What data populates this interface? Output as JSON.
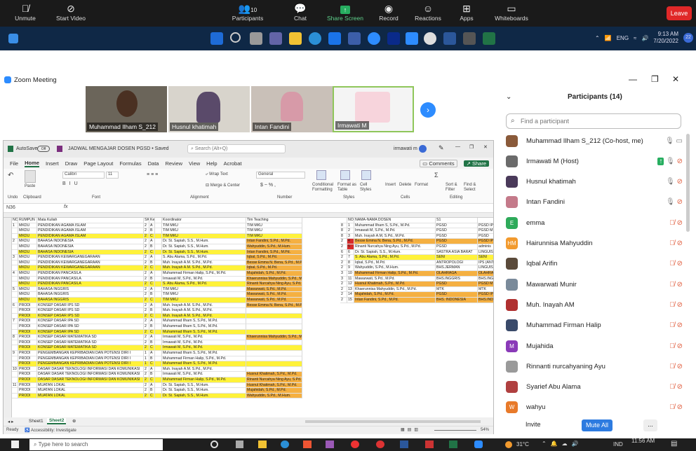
{
  "zoom_toolbar": {
    "unmute": "Unmute",
    "start_video": "Start Video",
    "participants": "Participants",
    "participants_count": "10",
    "chat": "Chat",
    "share": "Share Screen",
    "record": "Record",
    "reactions": "Reactions",
    "apps": "Apps",
    "whiteboards": "Whiteboards",
    "leave": "Leave"
  },
  "taskbar1": {
    "lang": "ENG",
    "time": "9:13 AM",
    "date": "7/20/2022",
    "badge": "22"
  },
  "zoom_window": {
    "title": "Zoom Meeting"
  },
  "gallery": [
    {
      "name": "Muhammad Ilham S_212"
    },
    {
      "name": "Husnul khatimah"
    },
    {
      "name": "Intan Fandini"
    },
    {
      "name": "Irmawati M"
    }
  ],
  "excel": {
    "autosave": "AutoSave",
    "autosave_state": "Off",
    "doc": "JADWAL MENGAJAR DOSEN PGSD • Saved",
    "search": "Search (Alt+Q)",
    "user": "irmawati m",
    "tabs": [
      "File",
      "Home",
      "Insert",
      "Draw",
      "Page Layout",
      "Formulas",
      "Data",
      "Review",
      "View",
      "Help",
      "Acrobat"
    ],
    "comments": "Comments",
    "share": "Share",
    "namebox": "N36",
    "fx": "fx",
    "ribbon": {
      "paste": "Paste",
      "clipboard": "Clipboard",
      "font": "Calibri",
      "size": "11",
      "font_group": "Font",
      "alignment": "Alignment",
      "wrap": "Wrap Text",
      "merge": "Merge & Center",
      "number_fmt": "General",
      "number": "Number",
      "cond": "Conditional Formatting",
      "fmt_table": "Format as Table",
      "cell_styles": "Cell Styles",
      "styles": "Styles",
      "insert": "Insert",
      "delete": "Delete",
      "format": "Format",
      "cells": "Cells",
      "sort": "Sort & Filter",
      "find": "Find & Select",
      "editing": "Editing",
      "undo": "Undo"
    },
    "headers": {
      "no": "NO",
      "rumpun": "RUMPUN",
      "mk": "Mata Kuliah",
      "sks": "SKS",
      "kelas": "Kelas",
      "koord": "Koordinator",
      "tim": "Tim Teaching"
    },
    "rows": [
      [
        "1",
        "MKDU",
        "PENDIDIKAN AGAMA ISLAM",
        "2",
        "A",
        "",
        "TIM MKU",
        "TIM MKU"
      ],
      [
        "",
        "MKDU",
        "PENDIDIKAN AGAMA ISLAM",
        "2",
        "B",
        "",
        "TIM MKU",
        "TIM MKU"
      ],
      [
        "",
        "MKDU",
        "PENDIDIKAN AGAMA ISLAM",
        "2",
        "C",
        "",
        "TIM MKU",
        "TIM MKU"
      ],
      [
        "2",
        "MKDU",
        "BAHASA INDONESIA",
        "2",
        "A",
        "",
        "Dr. St. Sapiah, S.S., M.Hum.",
        "Intan Fandini, S.Pd., M.Pd."
      ],
      [
        "",
        "MKDU",
        "BAHASA INDONESIA",
        "2",
        "B",
        "",
        "Dr. St. Sapiah, S.S., M.Hum.",
        "Wahyuddin, S.Pd., M.Hum."
      ],
      [
        "",
        "MKDU",
        "BAHASA INDONESIA",
        "2",
        "C",
        "",
        "Dr. St. Sapiah, S.S., M.Hum.",
        "Intan Fandini, S.Pd., M.Pd."
      ],
      [
        "3",
        "MKDU",
        "PENDIDIKAN KEWARGANEGARAAN",
        "2",
        "A",
        "",
        "S. Abu Alama, S.Pd., M.Pd.",
        "Iqbal, S.Pd., M.Pd."
      ],
      [
        "",
        "MKDU",
        "PENDIDIKAN KEWARGANEGARAAN",
        "2",
        "B",
        "",
        "Muh. Inayah A.M. S.Pd., M.Pd.",
        "Besse Emma N. Bena, S.Pd., M.Pd."
      ],
      [
        "",
        "MKDU",
        "PENDIDIKAN KEWARGANEGARAAN",
        "2",
        "C",
        "",
        "Muh. Inayah A.M. S.Pd., M.Pd.",
        "Iqbal, S.Pd., M.Pd."
      ],
      [
        "4",
        "MKDU",
        "PENDIDIKAN PANCASILA",
        "2",
        "A",
        "",
        "Muhammad Firman Halip, S.Pd., M.Pd.",
        "Mujahidah, S.Pd., M.Pd."
      ],
      [
        "",
        "MKDU",
        "PENDIDIKAN PANCASILA",
        "2",
        "B",
        "",
        "Irmawati M, S.Pd., M.Pd.",
        "Khaerunnisa Mahyuddin, S.Pd., M.Pd."
      ],
      [
        "",
        "MKDU",
        "PENDIDIKAN PANCASILA",
        "2",
        "C",
        "",
        "S. Abu Alama, S.Pd., M.Pd.",
        "Rinanti Nurcahya Ning Ayu, S.Pd., M.Pd."
      ],
      [
        "5",
        "MKDU",
        "BAHASA INGGRIS",
        "2",
        "A",
        "",
        "TIM MKU",
        "Mawarwati, S.Pd., M.Pd."
      ],
      [
        "",
        "MKDU",
        "BAHASA INGGRIS",
        "2",
        "B",
        "",
        "TIM MKU",
        "Mawarwati, S.Pd., M.Pd."
      ],
      [
        "",
        "MKDU",
        "BAHASA INGGRIS",
        "2",
        "C",
        "",
        "TIM MKU",
        "Mawarwati, S.Pd., M.Pd."
      ],
      [
        "6",
        "PRODI",
        "KONSEP DASAR IPS SD",
        "2",
        "A",
        "",
        "Muh. Inayah A.M. S.Pd., M.Pd.",
        "Besse Emma N. Bena, S.Pd., M.Pd."
      ],
      [
        "",
        "PRODI",
        "KONSEP DASAR IPS SD",
        "2",
        "B",
        "",
        "Muh. Inayah A.M. S.Pd., M.Pd.",
        ""
      ],
      [
        "",
        "PRODI",
        "KONSEP DASAR IPS SD",
        "2",
        "C",
        "",
        "Muh. Inayah A.M. S.Pd., M.Pd.",
        ""
      ],
      [
        "7",
        "PRODI",
        "KONSEP DASAR IPA SD",
        "2",
        "A",
        "",
        "Muhammad Ilham S, S.Pd., M.Pd.",
        ""
      ],
      [
        "",
        "PRODI",
        "KONSEP DASAR IPA SD",
        "2",
        "B",
        "",
        "Muhammad Ilham S, S.Pd., M.Pd.",
        ""
      ],
      [
        "",
        "PRODI",
        "KONSEP DASAR IPA SD",
        "2",
        "C",
        "",
        "Muhammad Ilham S, S.Pd., M.Pd.",
        ""
      ],
      [
        "8",
        "PRODI",
        "KONSEP DASAR MATEMATIKA SD",
        "2",
        "A",
        "",
        "Irmawati M, S.Pd., M.Pd.",
        "Khaerunnisa Mahyuddin, S.Pd., M.Pd."
      ],
      [
        "",
        "PRODI",
        "KONSEP DASAR MATEMATIKA SD",
        "2",
        "B",
        "",
        "Irmawati M, S.Pd., M.Pd.",
        ""
      ],
      [
        "",
        "PRODI",
        "KONSEP DASAR MATEMATIKA SD",
        "2",
        "C",
        "",
        "Irmawati M, S.Pd., M.Pd.",
        ""
      ],
      [
        "9",
        "PRODI",
        "PENGEMBANGAN KEPRIBADIAN DAN POTENSI DIRI I",
        "1",
        "A",
        "",
        "Muhammad Ilham S, S.Pd., M.Pd.",
        ""
      ],
      [
        "",
        "PRODI",
        "PENGEMBANGAN KEPRIBADIAN DAN POTENSI DIRI I",
        "1",
        "B",
        "",
        "Muhammad Firman Halip, S.Pd., M.Pd.",
        ""
      ],
      [
        "",
        "PRODI",
        "PENGEMBANGAN KEPRIBADIAN DAN POTENSI DIRI I",
        "1",
        "C",
        "",
        "Muhammad Ilham S, S.Pd., M.Pd.",
        ""
      ],
      [
        "10",
        "PRODI",
        "DASAR DASAR TEKNOLOGI INFORMASI DAN KOMUNIKASI",
        "2",
        "A",
        "",
        "Muh. Inayah A.M. S.Pd., M.Pd.",
        ""
      ],
      [
        "",
        "PRODI",
        "DASAR DASAR TEKNOLOGI INFORMASI DAN KOMUNIKASI",
        "2",
        "B",
        "",
        "Irmawati M, S.Pd., M.Pd.",
        "Husnul Khatimah, S.Pd., M.Pd."
      ],
      [
        "",
        "PRODI",
        "DASAR DASAR TEKNOLOGI INFORMASI DAN KOMUNIKASI",
        "2",
        "C",
        "",
        "Muhammad Firman Halip, S.Pd., M.Pd.",
        "Rinanti Nurcahya Ning Ayu, S.Pd., M.Pd."
      ],
      [
        "11",
        "PRODI",
        "MUATAN LOKAL",
        "2",
        "A",
        "",
        "Dr. St. Sapiah, S.S., M.Hum.",
        "Husnul Khatimah, S.Pd., M.Pd."
      ],
      [
        "",
        "PRODI",
        "MUATAN LOKAL",
        "2",
        "B",
        "",
        "Dr. St. Sapiah, S.S., M.Hum.",
        "Mujahidah, S.Pd., M.Pd."
      ],
      [
        "",
        "PRODI",
        "MUATAN LOKAL",
        "2",
        "C",
        "",
        "Dr. St. Sapiah, S.S., M.Hum.",
        "Wahyuddin, S.Pd., M.Hum."
      ]
    ],
    "right_headers": {
      "no": "NO",
      "nama": "NAMA-NAMA DOSEN",
      "s1": "S1"
    },
    "right_rows": [
      [
        "8",
        "1",
        "Muhammad Ilham S, S.Pd., M.Pd.",
        "PGSD",
        "PGSD IP"
      ],
      [
        "8",
        "2",
        "Irmawati M, S.Pd., M.Pd.",
        "PGSD",
        "PGSD M"
      ],
      [
        "8",
        "3",
        "Muh. Inayah A.M, S.Pd., M.Pd.",
        "PGSD",
        "PGSD"
      ],
      [
        "2",
        "4",
        "Besse Emma N. Bena, S.Pd., M.Pd.",
        "PGSD",
        "PGSD IP"
      ],
      [
        "2",
        "5",
        "Rinanti Nurcahya Ning Ayu, S.Pd., M.Pd.",
        "PGSD",
        "adminis"
      ],
      [
        "6",
        "6",
        "Dr. St. Sapiah, S.S., M.Hum.",
        "SASTRA ASIA BARAT",
        "LINGUIS"
      ],
      [
        "2",
        "7",
        "S. Abu Alama, S.Pd., M.Pd.",
        "SENI",
        "SENI"
      ],
      [
        "2",
        "8",
        "Iqbal, S.Pd., M.Pd.",
        "ANTROPOLOGI",
        "IPS (ANT"
      ],
      [
        "2",
        "9",
        "Wahyuddin, S.Pd., M.Hum.",
        "BHS.JERMAN",
        "LINGUIS"
      ],
      [
        "3",
        "10",
        "Muhammad Firman Halip, S.Pd., M.Pd.",
        "OLAHRAGA",
        "OLAHRA"
      ],
      [
        "3",
        "11",
        "Mawarwati, S.Pd., M.Pd.",
        "BHS.INGGRIS",
        "BHS.ING"
      ],
      [
        "2",
        "12",
        "Husnul Khatimah, S.Pd., M.Pd.",
        "PGSD",
        "PGSD M"
      ],
      [
        "2",
        "13",
        "Khaerunnisa Mahyuddin, S.Pd., M.Pd.",
        "MTK",
        "MTK"
      ],
      [
        "2",
        "14",
        "Mujahidah, S.Pd., M.Pd.",
        "PGSD",
        "PGSD IP"
      ],
      [
        "2",
        "15",
        "Intan Fandini, S.Pd., M.Pd.",
        "BHS. INDONESIA",
        "BHS.IND"
      ]
    ],
    "sheets": [
      "Sheet1",
      "Sheet2"
    ],
    "status_ready": "Ready",
    "accessibility": "Accessibility: Investigate",
    "zoom_pct": "54%"
  },
  "participants_panel": {
    "title": "Participants (14)",
    "search_placeholder": "Find a participant",
    "invite": "Invite",
    "mute_all": "Mute All",
    "more": "...",
    "list": [
      {
        "name": "Muhammad Ilham S_212 (Co-host, me)",
        "initials": "",
        "color": "#8a5a3a",
        "muted": false
      },
      {
        "name": "Irmawati M (Host)",
        "initials": "",
        "color": "#6b6b6b",
        "muted": true
      },
      {
        "name": "Husnul khatimah",
        "initials": "",
        "color": "#4a3a5a",
        "muted": true
      },
      {
        "name": "Intan Fandini",
        "initials": "",
        "color": "#c47a8a",
        "muted": true
      },
      {
        "name": "emma",
        "initials": "E",
        "color": "#2eaa5a",
        "muted": true
      },
      {
        "name": "Hairunnisa Mahyuddin",
        "initials": "HM",
        "color": "#f29a2e",
        "muted": true
      },
      {
        "name": "Iqbal Arifin",
        "initials": "",
        "color": "#5a4a3a",
        "muted": true
      },
      {
        "name": "Mawarwati Munir",
        "initials": "",
        "color": "#7a8a9a",
        "muted": true
      },
      {
        "name": "Muh. Inayah AM",
        "initials": "",
        "color": "#b03030",
        "muted": true
      },
      {
        "name": "Muhammad Firman Halip",
        "initials": "",
        "color": "#3a4a6a",
        "muted": true
      },
      {
        "name": "Mujahida",
        "initials": "M",
        "color": "#8a3ab8",
        "muted": true
      },
      {
        "name": "Rinnanti nurcahyaning Ayu",
        "initials": "",
        "color": "#9a9a9a",
        "muted": true
      },
      {
        "name": "Syarief Abu Alama",
        "initials": "",
        "color": "#b04040",
        "muted": true
      },
      {
        "name": "wahyu",
        "initials": "W",
        "color": "#e87a2a",
        "muted": true
      }
    ]
  },
  "taskbar2": {
    "search": "Type here to search",
    "temp": "31°C",
    "lang": "IND",
    "time": "11:56 AM"
  }
}
